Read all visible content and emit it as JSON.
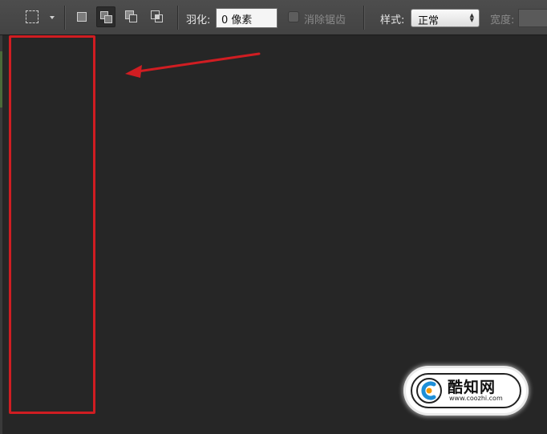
{
  "options_bar": {
    "feather_label": "羽化:",
    "feather_value": "0 像素",
    "antialias_label": "消除锯齿",
    "style_label": "样式:",
    "style_value": "正常",
    "width_label": "宽度:"
  },
  "icons": {
    "marquee": "rect-marquee-icon",
    "dropdown": "chevron-down-icon",
    "modes": [
      "new-selection-icon",
      "add-to-selection-icon",
      "subtract-from-selection-icon",
      "intersect-selection-icon"
    ]
  },
  "annotation": {
    "box_color": "#d01d22",
    "arrow_color": "#d01d22"
  },
  "watermark": {
    "title": "酷知网",
    "url": "www.coozhi.com",
    "logo_colors": [
      "#f39800",
      "#1d8fd8"
    ]
  },
  "colors": {
    "canvas": "#262626",
    "toolbar": "#474747"
  }
}
